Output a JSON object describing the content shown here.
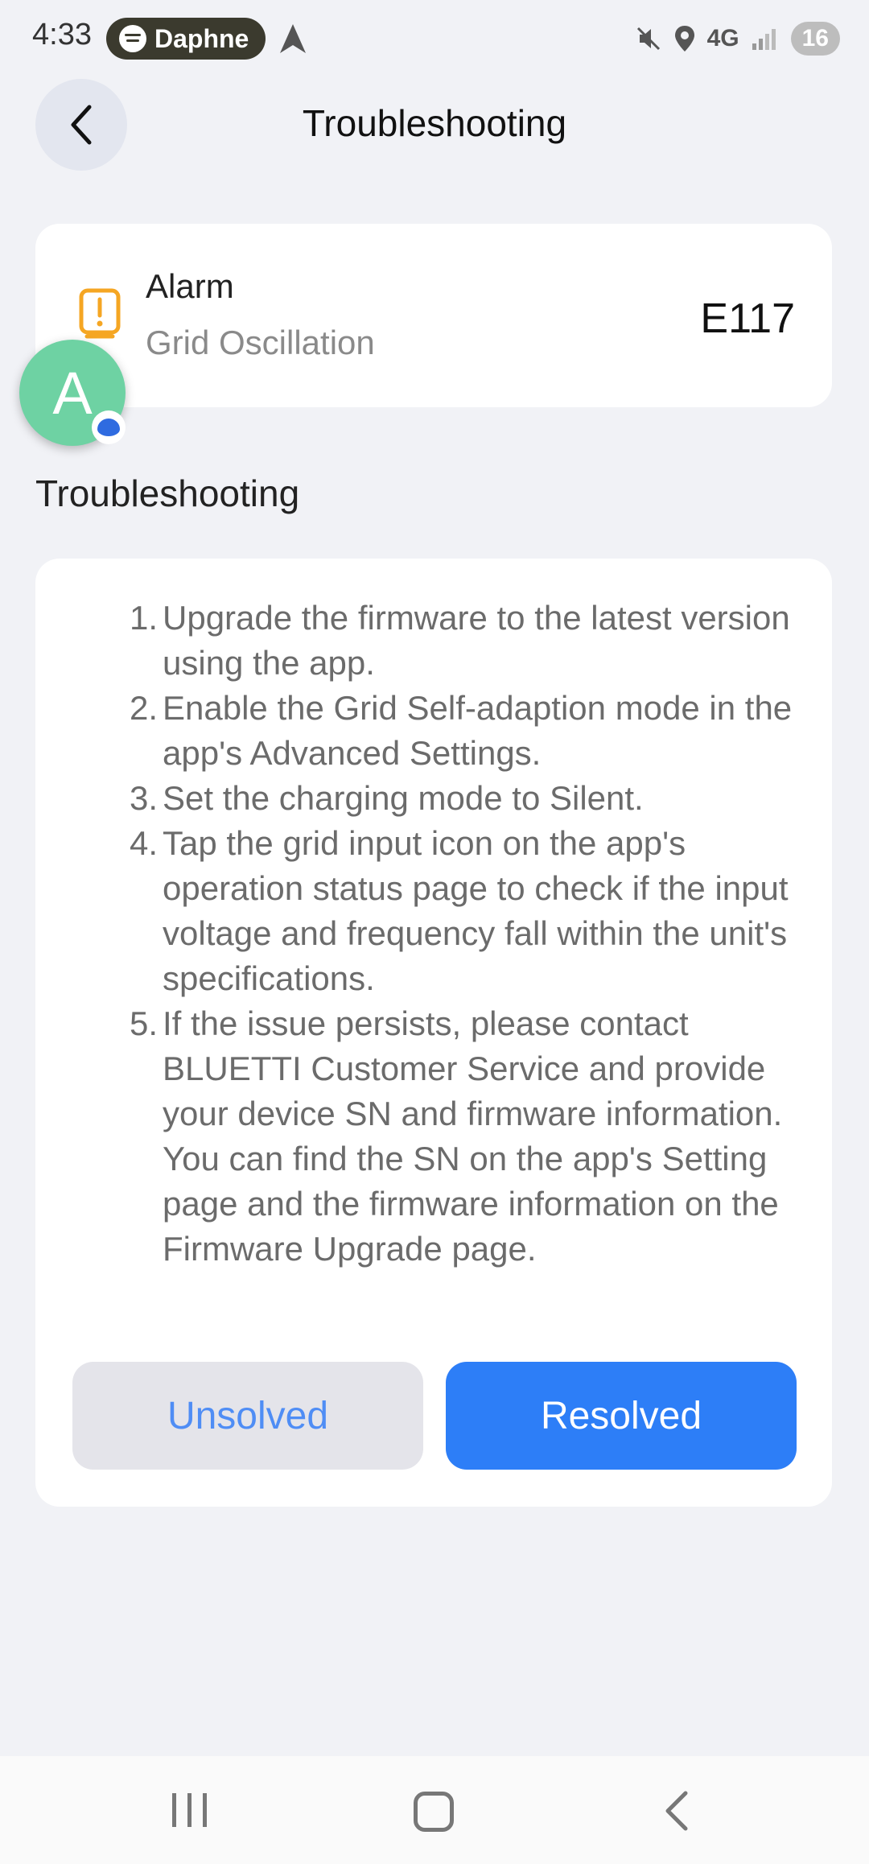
{
  "status_bar": {
    "time": "4:33",
    "media_app": "Daphne",
    "network": "4G",
    "battery": "16"
  },
  "header": {
    "title": "Troubleshooting",
    "back_icon": "chevron-left-icon"
  },
  "alarm": {
    "label": "Alarm",
    "description": "Grid Oscillation",
    "code": "E117",
    "icon": "alert-icon",
    "accent_color": "#f5a623"
  },
  "chat_bubble": {
    "letter": "A"
  },
  "section": {
    "title": "Troubleshooting"
  },
  "steps": [
    {
      "num": "1.",
      "text": "Upgrade the firmware to the latest version using the app."
    },
    {
      "num": "2.",
      "text": "Enable the Grid Self-adaption mode in the app's Advanced Settings."
    },
    {
      "num": "3.",
      "text": "Set the charging mode to Silent."
    },
    {
      "num": "4.",
      "text": "Tap the grid input icon on the app's operation status page to check if the input voltage and frequency fall within the unit's specifications."
    },
    {
      "num": "5.",
      "text": "If the issue persists, please contact BLUETTI Customer Service and provide your device SN and firmware information. You can find the SN on the app's Setting page and the firmware information on the Firmware Upgrade page."
    }
  ],
  "buttons": {
    "unsolved": "Unsolved",
    "resolved": "Resolved"
  },
  "colors": {
    "primary": "#2d7ef7",
    "background": "#f1f2f6"
  }
}
